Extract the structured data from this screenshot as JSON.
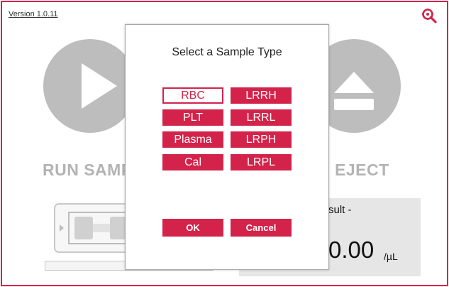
{
  "header": {
    "version_label": "Version 1.0.11"
  },
  "main": {
    "run_label": "RUN SAMP",
    "eject_label": "EJECT"
  },
  "result": {
    "title": "sult -",
    "value": "0.00",
    "unit": "/µL"
  },
  "progress": {
    "value": 0
  },
  "dialog": {
    "title": "Select a Sample Type",
    "sample_types": [
      {
        "label": "RBC",
        "selected": true
      },
      {
        "label": "LRRH",
        "selected": false
      },
      {
        "label": "PLT",
        "selected": false
      },
      {
        "label": "LRRL",
        "selected": false
      },
      {
        "label": "Plasma",
        "selected": false
      },
      {
        "label": "LRPH",
        "selected": false
      },
      {
        "label": "Cal",
        "selected": false
      },
      {
        "label": "LRPL",
        "selected": false
      }
    ],
    "ok_label": "OK",
    "cancel_label": "Cancel"
  },
  "colors": {
    "accent": "#d3234a",
    "icon_gray": "#bdbdbd",
    "panel_gray": "#e6e6e6"
  },
  "icons": {
    "settings": "settings-magnifier-icon",
    "run": "play-icon",
    "eject": "eject-icon",
    "cartridge": "cartridge-icon"
  }
}
